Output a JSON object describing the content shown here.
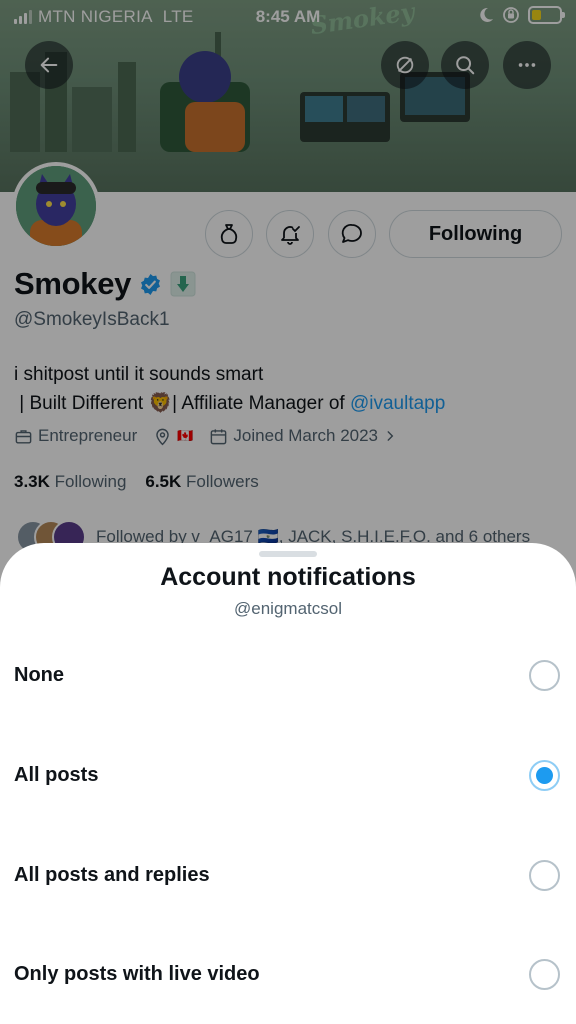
{
  "status_bar": {
    "carrier": "MTN NIGERIA",
    "network": "LTE",
    "time": "8:45 AM",
    "battery_color": "#f7d91a"
  },
  "header_actions": [
    "back-icon",
    "grok-icon",
    "search-icon",
    "more-icon"
  ],
  "banner": {
    "tag": "Smokey"
  },
  "profile": {
    "name": "Smokey",
    "handle": "@SmokeyIsBack1",
    "bio_line1": "i shitpost until it sounds smart",
    "bio_line2_before": "| Built Different",
    "bio_emoji": "🦁",
    "bio_line2_middle": "| Affiliate Manager of",
    "bio_link": "@ivaultapp",
    "category": "Entrepreneur",
    "location_flag": "🇨🇦",
    "joined": "Joined March 2023",
    "following_count": "3.3K",
    "following_label": "Following",
    "followers_count": "6.5K",
    "followers_label": "Followers",
    "followed_by": "Followed by v_AG17 🇸🇻, JACK, S.H.I.E.F.O. and 6 others",
    "follow_button": "Following",
    "verified_color": "#1d9bf0"
  },
  "sheet": {
    "title": "Account notifications",
    "subtitle": "@enigmatcsol",
    "options": [
      {
        "label": "None",
        "selected": false
      },
      {
        "label": "All posts",
        "selected": true
      },
      {
        "label": "All posts and replies",
        "selected": false
      },
      {
        "label": "Only posts with live video",
        "selected": false
      }
    ]
  }
}
